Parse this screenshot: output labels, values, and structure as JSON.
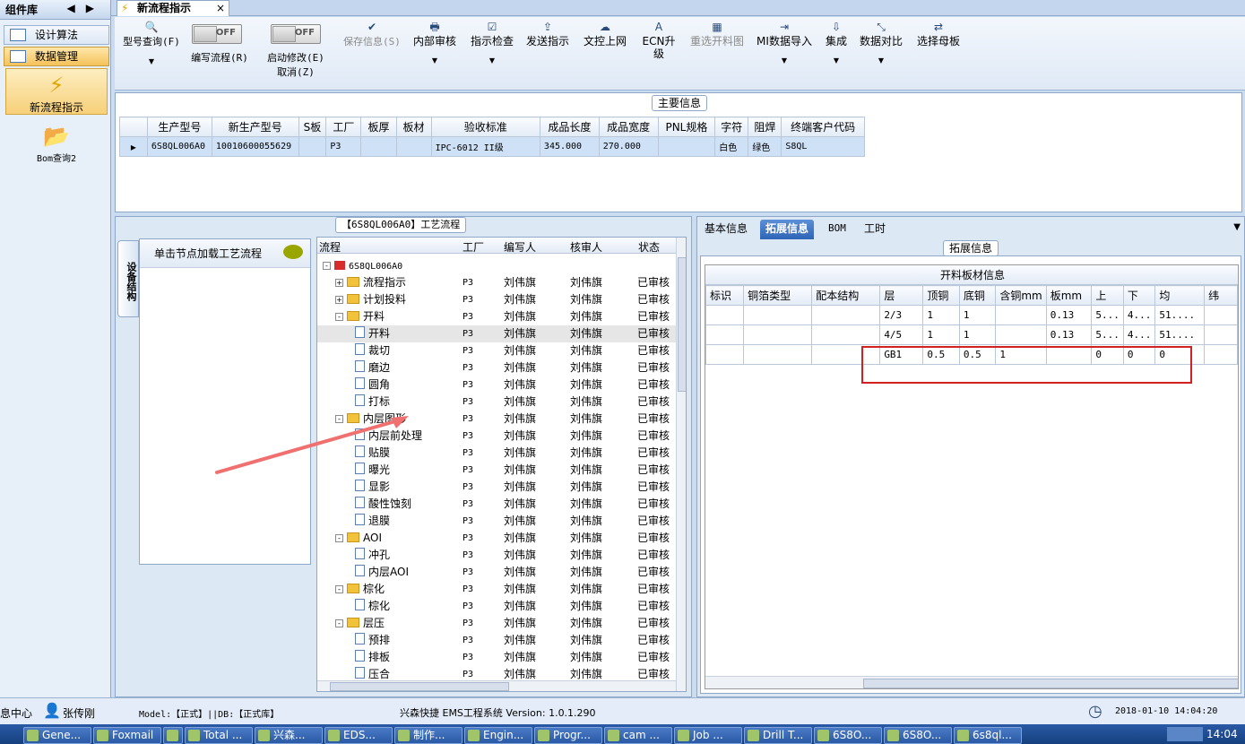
{
  "leftnav": {
    "header": "组件库",
    "items": [
      {
        "label": "设计算法",
        "active": false
      },
      {
        "label": "数据管理",
        "active": true
      }
    ],
    "big": [
      {
        "label": "新流程指示",
        "active": true
      },
      {
        "label": "Bom查询2",
        "active": false
      }
    ]
  },
  "tab": {
    "title": "新流程指示",
    "close": "×"
  },
  "toolbar": {
    "query": "型号查询(F)",
    "toggle_off": "OFF",
    "write_flow": "编写流程(R)",
    "start_modify": "启动修改(E)",
    "cancel": "取消(Z)",
    "save": "保存信息(S)",
    "internal_review": "内部审核",
    "check": "指示检查",
    "send": "发送指示",
    "upload": "文控上网",
    "ecn": "ECN升级",
    "reselect": "重选开料图",
    "mi_import": "MI数据导入",
    "integrate": "集成",
    "compare": "数据对比",
    "select_board": "选择母板"
  },
  "main_info": {
    "title": "主要信息",
    "columns": [
      "生产型号",
      "新生产型号",
      "S板",
      "工厂",
      "板厚",
      "板材",
      "验收标准",
      "成品长度",
      "成品宽度",
      "PNL规格",
      "字符",
      "阻焊",
      "终端客户代码"
    ],
    "row": [
      "6S8QL006A0",
      "10010600055629",
      "",
      "P3",
      "",
      "",
      "IPC-6012 II级",
      "345.000",
      "270.000",
      "",
      "白色",
      "绿色",
      "S8QL"
    ]
  },
  "process": {
    "title": "【6S8QL006A0】工艺流程",
    "vtab": "设备结构",
    "node_hint": "单击节点加载工艺流程",
    "columns": [
      "流程",
      "工厂",
      "编写人",
      "核审人",
      "状态"
    ],
    "root": "6S8QL006A0",
    "rows": [
      {
        "name": "流程指示",
        "lvl": 1,
        "type": "folder",
        "exp": "+"
      },
      {
        "name": "计划投料",
        "lvl": 1,
        "type": "folder",
        "exp": "+"
      },
      {
        "name": "开料",
        "lvl": 1,
        "type": "folder",
        "exp": "-"
      },
      {
        "name": "开料",
        "lvl": 2,
        "type": "doc",
        "sel": true
      },
      {
        "name": "裁切",
        "lvl": 2,
        "type": "doc"
      },
      {
        "name": "磨边",
        "lvl": 2,
        "type": "doc"
      },
      {
        "name": "圆角",
        "lvl": 2,
        "type": "doc"
      },
      {
        "name": "打标",
        "lvl": 2,
        "type": "doc"
      },
      {
        "name": "内层图形",
        "lvl": 1,
        "type": "folder",
        "exp": "-"
      },
      {
        "name": "内层前处理",
        "lvl": 2,
        "type": "doc"
      },
      {
        "name": "贴膜",
        "lvl": 2,
        "type": "doc"
      },
      {
        "name": "曝光",
        "lvl": 2,
        "type": "doc"
      },
      {
        "name": "显影",
        "lvl": 2,
        "type": "doc"
      },
      {
        "name": "酸性蚀刻",
        "lvl": 2,
        "type": "doc"
      },
      {
        "name": "退膜",
        "lvl": 2,
        "type": "doc"
      },
      {
        "name": "AOI",
        "lvl": 1,
        "type": "folder",
        "exp": "-"
      },
      {
        "name": "冲孔",
        "lvl": 2,
        "type": "doc"
      },
      {
        "name": "内层AOI",
        "lvl": 2,
        "type": "doc"
      },
      {
        "name": "棕化",
        "lvl": 1,
        "type": "folder",
        "exp": "-"
      },
      {
        "name": "棕化",
        "lvl": 2,
        "type": "doc"
      },
      {
        "name": "层压",
        "lvl": 1,
        "type": "folder",
        "exp": "-"
      },
      {
        "name": "预排",
        "lvl": 2,
        "type": "doc"
      },
      {
        "name": "排板",
        "lvl": 2,
        "type": "doc"
      },
      {
        "name": "压合",
        "lvl": 2,
        "type": "doc"
      }
    ],
    "factory": "P3",
    "writer": "刘伟旗",
    "reviewer": "刘伟旗",
    "status": "已审核"
  },
  "right": {
    "tabs": [
      "基本信息",
      "拓展信息",
      "BOM",
      "工时"
    ],
    "active_tab": 1,
    "section_title": "拓展信息",
    "grid_title": "开料板材信息",
    "columns": [
      "标识",
      "铜箔类型",
      "配本结构",
      "层",
      "顶铜",
      "底铜",
      "含铜mm",
      "板mm",
      "上",
      "下",
      "均",
      "纬"
    ],
    "rows": [
      [
        "",
        "",
        "",
        "2/3",
        "1",
        "1",
        "",
        "0.13",
        "5...",
        "4...",
        "51....",
        ""
      ],
      [
        "",
        "",
        "",
        "4/5",
        "1",
        "1",
        "",
        "0.13",
        "5...",
        "4...",
        "51....",
        ""
      ],
      [
        "",
        "",
        "",
        "GB1",
        "0.5",
        "0.5",
        "1",
        "",
        "0",
        "0",
        "0",
        ""
      ]
    ]
  },
  "status": {
    "left": "息中心",
    "user": "张传刚",
    "model": "Model:【正式】||DB:【正式库】",
    "system": "兴森快捷 EMS工程系统 Version: 1.0.1.290",
    "datetime": "2018-01-10 14:04:20"
  },
  "taskbar": {
    "items": [
      "Gene...",
      "Foxmail",
      "",
      "Total ...",
      "兴森...",
      "EDS...",
      "制作...",
      "Engin...",
      "Progr...",
      "cam ...",
      "Job ...",
      "Drill T...",
      "6S8O...",
      "6S8O...",
      "6s8ql..."
    ],
    "time": "14:04"
  },
  "colors": {
    "accent": "#2d64b6",
    "highlight_box": "#d32020",
    "arrow": "#f07070"
  }
}
